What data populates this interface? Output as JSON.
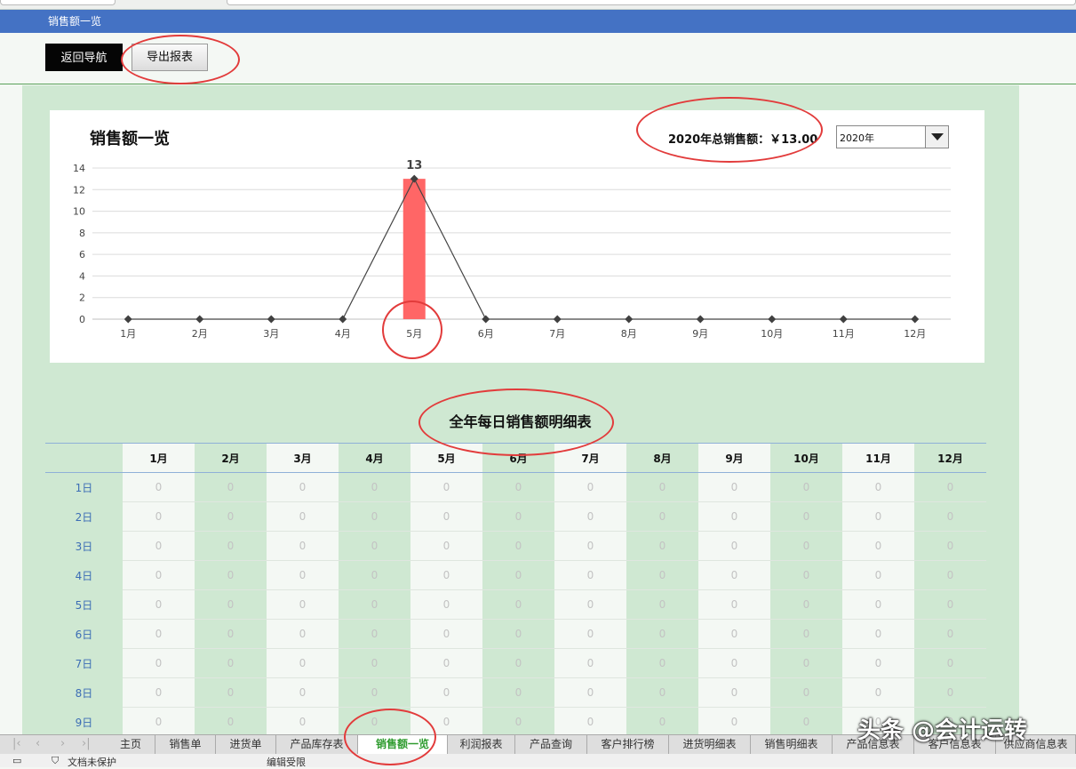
{
  "window": {
    "title": "销售额一览"
  },
  "toolbar": {
    "back_label": "返回导航",
    "export_label": "导出报表"
  },
  "summary": {
    "title": "销售额一览",
    "total_text": "2020年总销售额：￥13.00",
    "year_selected": "2020年"
  },
  "chart_data": {
    "type": "bar",
    "categories": [
      "1月",
      "2月",
      "3月",
      "4月",
      "5月",
      "6月",
      "7月",
      "8月",
      "9月",
      "10月",
      "11月",
      "12月"
    ],
    "series": [
      {
        "type": "bar",
        "values": [
          0,
          0,
          0,
          0,
          13,
          0,
          0,
          0,
          0,
          0,
          0,
          0
        ],
        "color": "#ff6666"
      },
      {
        "type": "line",
        "values": [
          0,
          0,
          0,
          0,
          13,
          0,
          0,
          0,
          0,
          0,
          0,
          0
        ],
        "color": "#444444"
      }
    ],
    "data_labels": [
      {
        "category": "5月",
        "text": "13"
      }
    ],
    "yticks": [
      "0",
      "2",
      "4",
      "6",
      "8",
      "10",
      "12",
      "14"
    ],
    "ylim": [
      0,
      14
    ],
    "grid": true
  },
  "daily_table": {
    "title": "全年每日销售额明细表",
    "months": [
      "1月",
      "2月",
      "3月",
      "4月",
      "5月",
      "6月",
      "7月",
      "8月",
      "9月",
      "10月",
      "11月",
      "12月"
    ],
    "rows": [
      {
        "day": "1日",
        "values": [
          "0",
          "0",
          "0",
          "0",
          "0",
          "0",
          "0",
          "0",
          "0",
          "0",
          "0",
          "0"
        ]
      },
      {
        "day": "2日",
        "values": [
          "0",
          "0",
          "0",
          "0",
          "0",
          "0",
          "0",
          "0",
          "0",
          "0",
          "0",
          "0"
        ]
      },
      {
        "day": "3日",
        "values": [
          "0",
          "0",
          "0",
          "0",
          "0",
          "0",
          "0",
          "0",
          "0",
          "0",
          "0",
          "0"
        ]
      },
      {
        "day": "4日",
        "values": [
          "0",
          "0",
          "0",
          "0",
          "0",
          "0",
          "0",
          "0",
          "0",
          "0",
          "0",
          "0"
        ]
      },
      {
        "day": "5日",
        "values": [
          "0",
          "0",
          "0",
          "0",
          "0",
          "0",
          "0",
          "0",
          "0",
          "0",
          "0",
          "0"
        ]
      },
      {
        "day": "6日",
        "values": [
          "0",
          "0",
          "0",
          "0",
          "0",
          "0",
          "0",
          "0",
          "0",
          "0",
          "0",
          "0"
        ]
      },
      {
        "day": "7日",
        "values": [
          "0",
          "0",
          "0",
          "0",
          "0",
          "0",
          "0",
          "0",
          "0",
          "0",
          "0",
          "0"
        ]
      },
      {
        "day": "8日",
        "values": [
          "0",
          "0",
          "0",
          "0",
          "0",
          "0",
          "0",
          "0",
          "0",
          "0",
          "0",
          "0"
        ]
      },
      {
        "day": "9日",
        "values": [
          "0",
          "0",
          "0",
          "0",
          "0",
          "0",
          "0",
          "0",
          "0",
          "0",
          "0",
          "0"
        ]
      }
    ]
  },
  "sheet_tabs": [
    "主页",
    "销售单",
    "进货单",
    "产品库存表",
    "销售额一览",
    "利润报表",
    "产品查询",
    "客户排行榜",
    "进货明细表",
    "销售明细表",
    "产品信息表",
    "客户信息表",
    "供应商信息表"
  ],
  "active_tab": "销售额一览",
  "status_bar": {
    "protect": "文档未保护",
    "edit": "编辑受限"
  },
  "watermark": "头条 @会计运转",
  "colors": {
    "title_bar": "#4472c4",
    "accent_green": "#2e9b2e",
    "annotation": "#e23b3b"
  }
}
